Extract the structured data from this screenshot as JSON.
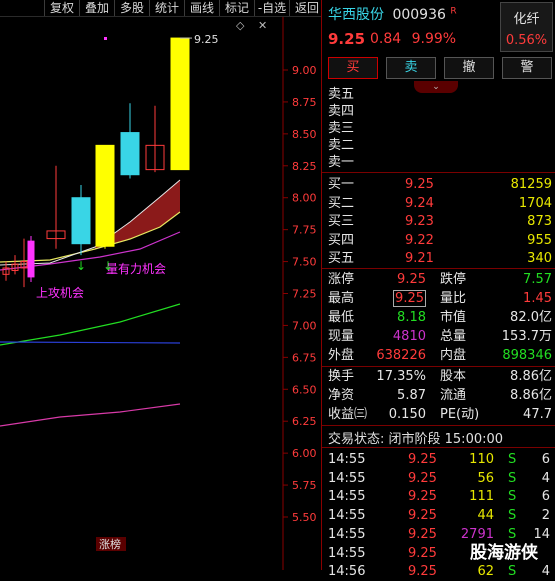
{
  "toolbar": {
    "buttons": [
      "复权",
      "叠加",
      "多股",
      "统计",
      "画线",
      "标记",
      "-自选",
      "返回"
    ],
    "diamond_icon": "diamond-icon",
    "close_icon": "close-icon"
  },
  "chart_data": {
    "type": "candlestick",
    "y_ticks": [
      "9.00",
      "8.75",
      "8.50",
      "8.25",
      "8.00",
      "7.75",
      "7.50",
      "7.25",
      "7.00",
      "6.75",
      "6.50",
      "6.25",
      "6.00",
      "5.75",
      "5.50"
    ],
    "ylim": [
      5.4,
      9.35
    ],
    "candles": [
      {
        "open": 7.4,
        "close": 7.45,
        "high": 7.5,
        "low": 7.35
      },
      {
        "open": 7.43,
        "close": 7.48,
        "high": 7.55,
        "low": 7.4
      },
      {
        "open": 7.5,
        "close": 7.45,
        "high": 7.68,
        "low": 7.3
      },
      {
        "open": 7.38,
        "close": 7.66,
        "high": 7.7,
        "low": 7.34
      },
      {
        "open": 7.74,
        "close": 7.68,
        "high": 8.25,
        "low": 7.6
      },
      {
        "open": 7.98,
        "close": 7.72,
        "high": 8.1,
        "low": 7.55
      },
      {
        "open": 7.64,
        "close": 8.0,
        "high": 8.1,
        "low": 7.55
      },
      {
        "open": 7.62,
        "close": 8.41,
        "high": 8.41,
        "low": 7.6
      },
      {
        "open": 8.18,
        "close": 8.51,
        "high": 8.74,
        "low": 8.15
      },
      {
        "open": 8.41,
        "close": 8.22,
        "high": 8.72,
        "low": 8.2
      },
      {
        "open": 8.22,
        "close": 9.25,
        "high": 9.25,
        "low": 8.22
      }
    ],
    "price_label": "9.25",
    "annotations": [
      "量有力机会",
      "上攻机会"
    ],
    "bottom_tag": "涨榜"
  },
  "quote": {
    "name": "华西股份",
    "code": "000936",
    "flag": "R",
    "price": "9.25",
    "change": "0.84",
    "change_pct": "9.99%",
    "sector": "化纤",
    "sector_pct": "0.56%"
  },
  "actions": [
    "买",
    "卖",
    "撤",
    "警"
  ],
  "sell_levels": [
    "卖五",
    "卖四",
    "卖三",
    "卖二",
    "卖一"
  ],
  "buy_levels": [
    {
      "label": "买一",
      "price": "9.25",
      "vol": "81259"
    },
    {
      "label": "买二",
      "price": "9.24",
      "vol": "1704"
    },
    {
      "label": "买三",
      "price": "9.23",
      "vol": "873"
    },
    {
      "label": "买四",
      "price": "9.22",
      "vol": "955"
    },
    {
      "label": "买五",
      "price": "9.21",
      "vol": "340"
    }
  ],
  "stats": [
    {
      "l1": "涨停",
      "v1": "9.25",
      "l2": "跌停",
      "v2": "7.57"
    },
    {
      "l1": "最高",
      "v1": "9.25",
      "l2": "量比",
      "v2": "1.45"
    },
    {
      "l1": "最低",
      "v1": "8.18",
      "l2": "市值",
      "v2": "82.0亿"
    },
    {
      "l1": "现量",
      "v1": "4810",
      "l2": "总量",
      "v2": "153.7万"
    },
    {
      "l1": "外盘",
      "v1": "638226",
      "l2": "内盘",
      "v2": "898346"
    }
  ],
  "fund": [
    {
      "l1": "换手",
      "v1": "17.35%",
      "l2": "股本",
      "v2": "8.86亿"
    },
    {
      "l1": "净资",
      "v1": "5.87",
      "l2": "流通",
      "v2": "8.86亿"
    },
    {
      "l1": "收益㈢",
      "v1": "0.150",
      "l2": "PE(动)",
      "v2": "47.7"
    }
  ],
  "trade_status": "交易状态: 闭市阶段 15:00:00",
  "ticks": [
    {
      "time": "14:55",
      "price": "9.25",
      "vol": "110",
      "side": "S",
      "n": "6"
    },
    {
      "time": "14:55",
      "price": "9.25",
      "vol": "56",
      "side": "S",
      "n": "4"
    },
    {
      "time": "14:55",
      "price": "9.25",
      "vol": "111",
      "side": "S",
      "n": "6"
    },
    {
      "time": "14:55",
      "price": "9.25",
      "vol": "44",
      "side": "S",
      "n": "2"
    },
    {
      "time": "14:55",
      "price": "9.25",
      "vol": "2791",
      "side": "S",
      "n": "14"
    },
    {
      "time": "14:55",
      "price": "9.25",
      "vol": "",
      "side": "",
      "n": ""
    },
    {
      "time": "14:56",
      "price": "9.25",
      "vol": "62",
      "side": "S",
      "n": "4"
    }
  ],
  "watermark": "股海游侠"
}
